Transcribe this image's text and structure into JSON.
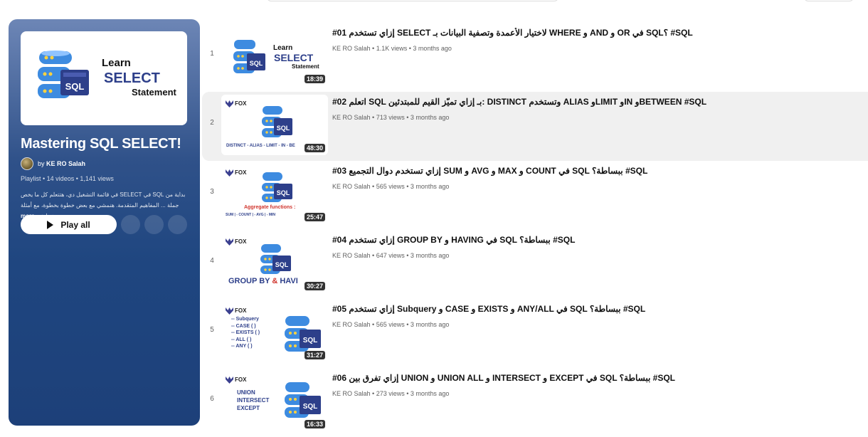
{
  "playlist": {
    "title": "Mastering SQL SELECT!",
    "owner_prefix": "by",
    "owner": "KE RO Salah",
    "type": "Playlist",
    "video_count": "14 videos",
    "views": "1,141 views",
    "description": "بداية من SQL في SELECT في قائمة التشغيل دي، هتتعلم كل ما يخص جملة ... المفاهيم المتقدمة. هنمشي مع بعض خطوة بخطوة، مع أمثلة عملية",
    "more_label": "...more",
    "play_all_label": "Play all",
    "cover": {
      "line1": "Learn",
      "line2": "SELECT",
      "line3": "Statement",
      "db_label": "SQL"
    }
  },
  "videos": [
    {
      "index": "1",
      "title": "#01 إزاي تستخدم SELECT لاختيار الأعمدة وتصفية البيانات بـ WHERE و AND و OR في SQL؟ #SQL",
      "channel": "KE RO Salah",
      "views": "1.1K views",
      "age": "3 months ago",
      "duration": "18:39",
      "thumb": {
        "kind": "learn",
        "line1": "Learn",
        "line2": "SELECT",
        "line3": "Statement",
        "db": "SQL"
      }
    },
    {
      "index": "2",
      "title": "#02 اتعلم SQL بـ إزاي تميّز القيم للمبتدئين: DISTINCT وتستخدم ALIAS وLIMIT وIN وBETWEEN #SQL",
      "channel": "KE RO Salah",
      "views": "713 views",
      "age": "3 months ago",
      "duration": "48:30",
      "thumb": {
        "kind": "fox",
        "brand": "FOX",
        "caption": "DISTINCT - ALIAS - LIMIT - IN - BE",
        "db": "SQL"
      }
    },
    {
      "index": "3",
      "title": "#03 إزاي تستخدم دوال التجميع SUM و AVG و MAX و COUNT في SQL ببساطة؟ #SQL",
      "channel": "KE RO Salah",
      "views": "565 views",
      "age": "3 months ago",
      "duration": "25:47",
      "thumb": {
        "kind": "agg",
        "brand": "FOX",
        "caption": "Aggregate functions :",
        "sub": "SUM | - COUNT | - AVG | - MIN",
        "db": "SQL"
      }
    },
    {
      "index": "4",
      "title": "#04 إزاي تستخدم GROUP BY و HAVING في SQL ببساطة؟ #SQL",
      "channel": "KE RO Salah",
      "views": "647 views",
      "age": "3 months ago",
      "duration": "30:27",
      "thumb": {
        "kind": "group",
        "brand": "FOX",
        "caption_a": "GROUP BY",
        "caption_amp": "&",
        "caption_b": "HAVI",
        "db": "SQL"
      }
    },
    {
      "index": "5",
      "title": "#05 إزاي تستخدم Subquery و CASE و EXISTS و ANY/ALL في SQL ببساطة؟ #SQL",
      "channel": "KE RO Salah",
      "views": "565 views",
      "age": "3 months ago",
      "duration": "31:27",
      "thumb": {
        "kind": "list",
        "brand": "FOX",
        "lines": [
          "-- Subquery",
          "-- CASE ( )",
          "-- EXISTS ( )",
          "-- ALL ( )",
          "-- ANY ( )"
        ],
        "db": "SQL"
      }
    },
    {
      "index": "6",
      "title": "#06 إزاي تفرق بين UNION و UNION ALL و INTERSECT و EXCEPT في SQL ببساطة؟ #SQL",
      "channel": "KE RO Salah",
      "views": "273 views",
      "age": "3 months ago",
      "duration": "16:33",
      "thumb": {
        "kind": "union",
        "brand": "FOX",
        "lines": [
          "UNION",
          "INTERSECT",
          "EXCEPT"
        ],
        "db": "SQL"
      }
    }
  ],
  "colors": {
    "panel": "#1f4680",
    "db_blue": "#3d8be0",
    "db_dark": "#2d3f8a",
    "accent_red": "#d0342c"
  }
}
